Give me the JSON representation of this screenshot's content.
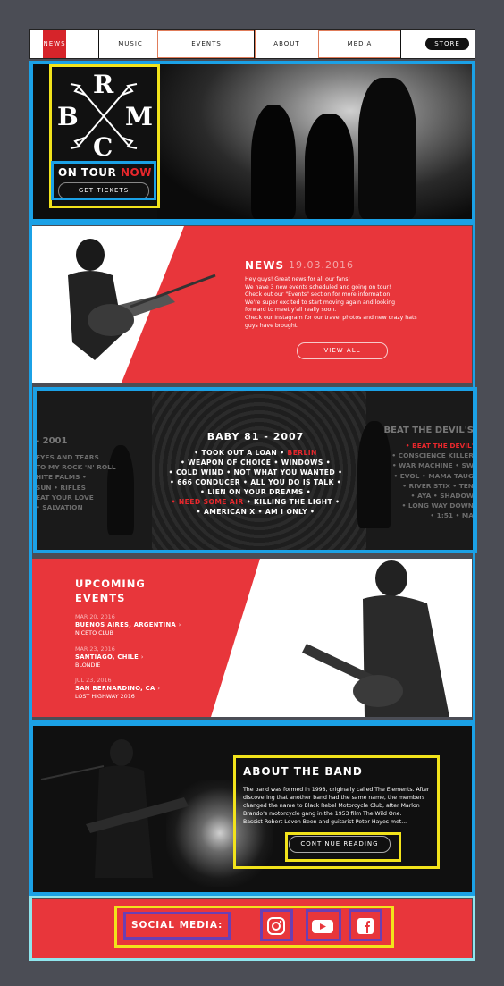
{
  "nav": {
    "items": [
      "NEWS",
      "MUSIC",
      "EVENTS",
      "ABOUT",
      "MEDIA"
    ],
    "store": "STORE"
  },
  "hero": {
    "logo_letters": [
      "R",
      "B",
      "M",
      "C"
    ],
    "on_tour": "ON TOUR",
    "now": "NOW",
    "tickets": "GET TICKETS"
  },
  "news": {
    "title": "NEWS",
    "date": "19.03.2016",
    "lines": [
      "Hey guys! Great news for all our fans!",
      "We have 3 new events scheduled and going on tour!",
      "Check out our \"Events\" section for more information.",
      "We're super excited to start moving again and looking",
      "forward to meet y'all really soon.",
      "Check our Instagram for our travel photos and new crazy hats",
      "guys have brought."
    ],
    "view_all": "VIEW ALL"
  },
  "discography": {
    "center_title": "BABY 81 - 2007",
    "lines": [
      [
        "• TOOK OUT A LOAN • ",
        "BERLIN",
        ""
      ],
      [
        "• WEAPON OF CHOICE • WINDOWS •",
        "",
        ""
      ],
      [
        "• COLD WIND • NOT WHAT YOU WANTED •",
        "",
        ""
      ],
      [
        "• 666 CONDUCER • ALL YOU DO IS TALK •",
        "",
        ""
      ],
      [
        "• LIEN ON YOUR DREAMS •",
        "",
        ""
      ],
      [
        "",
        "• NEED SOME AIR",
        " • KILLING THE LIGHT •"
      ],
      [
        "• AMERICAN X • AM I ONLY •",
        "",
        ""
      ]
    ],
    "left_head": "- 2001",
    "left_lines": [
      "EYES AND TEARS",
      "TO MY ROCK 'N' ROLL",
      "HITE PALMS •",
      "SUN • RIFLES",
      "EAT YOUR LOVE",
      "• SALVATION"
    ],
    "right_head": "BEAT THE DEVIL'S",
    "right_lines": [
      "• BEAT THE DEVIL'",
      "• CONSCIENCE KILLER",
      "• WAR MACHINE • SW",
      "• EVOL • MAMA TAUG",
      "• RIVER STIX • TEN",
      "• AYA • SHADOW",
      "• LONG WAY DOWN",
      "• 1:51 • MA"
    ]
  },
  "events": {
    "title_line1": "UPCOMING",
    "title_line2": "EVENTS",
    "list": [
      {
        "date": "MAR 20, 2016",
        "city": "BUENOS AIRES, ARGENTINA",
        "venue": "NICETO CLUB"
      },
      {
        "date": "MAR 23, 2016",
        "city": "SANTIAGO, CHILE",
        "venue": "BLONDIE"
      },
      {
        "date": "JUL 23, 2016",
        "city": "SAN BERNARDINO, CA",
        "venue": "LOST HIGHWAY 2016"
      }
    ],
    "arrow": "›"
  },
  "about": {
    "title": "ABOUT THE BAND",
    "lines": [
      "The band was formed in 1998, originally called The Elements. After",
      "discovering that another band had the same name, the members",
      "changed the name to Black Rebel Motorcycle Club, after Marlon",
      "Brando's motorcycle gang in the 1953 film The Wild One.",
      "Bassist Robert Levon Been and guitarist Peter Hayes met..."
    ],
    "continue": "CONTINUE READING"
  },
  "social": {
    "label": "SOCIAL MEDIA:",
    "icons": [
      "instagram-icon",
      "youtube-icon",
      "facebook-icon"
    ]
  },
  "colors": {
    "accent_red": "#e8363b",
    "annotation_blue": "#1ba1e6",
    "annotation_yellow": "#f2e31b",
    "annotation_purple": "#6b3fb3"
  }
}
